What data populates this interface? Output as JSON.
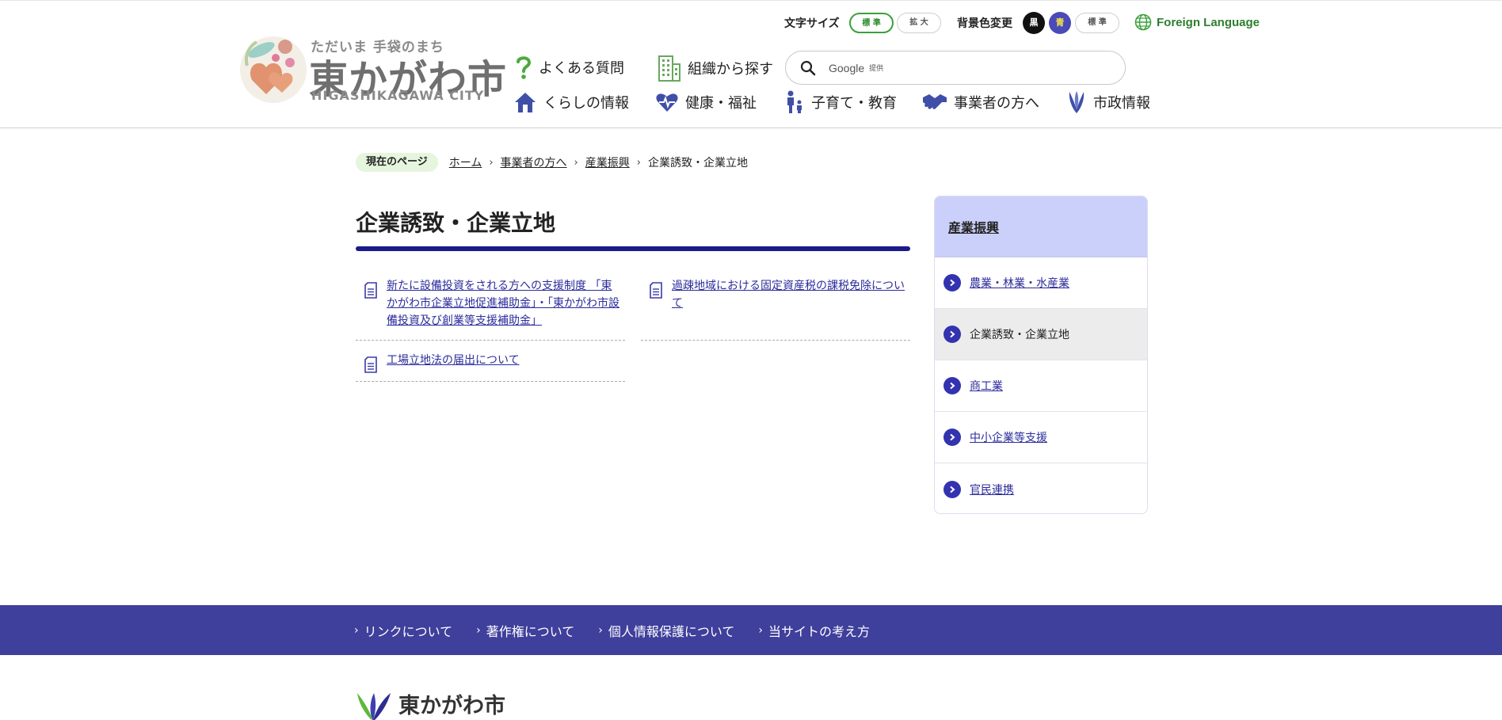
{
  "header": {
    "logo": {
      "tagline": "ただいま 手袋のまち",
      "name": "東かがわ市",
      "name_en": "HIGASHIKAGAWA CITY"
    },
    "font_size": {
      "label": "文字サイズ",
      "standard": "標 準",
      "large": "拡 大"
    },
    "background_color": {
      "label": "背景色変更",
      "black": "黒",
      "blue": "青",
      "standard": "標 準"
    },
    "foreign_language": "Foreign Language",
    "faq": "よくある質問",
    "org_search": "組織から探す",
    "search": {
      "provider": "Google",
      "provider_suffix": "提供"
    },
    "nav": [
      {
        "label": "くらしの情報",
        "icon": "house-icon"
      },
      {
        "label": "健康・福祉",
        "icon": "heart-pulse-icon"
      },
      {
        "label": "子育て・教育",
        "icon": "parent-child-icon"
      },
      {
        "label": "事業者の方へ",
        "icon": "handshake-icon"
      },
      {
        "label": "市政情報",
        "icon": "city-emblem-icon"
      }
    ]
  },
  "breadcrumb": {
    "label": "現在のページ",
    "items": [
      "ホーム",
      "事業者の方へ",
      "産業振興"
    ],
    "current": "企業誘致・企業立地"
  },
  "main": {
    "title": "企業誘致・企業立地",
    "links": [
      "新たに設備投資をされる方への支援制度 「東かがわ市企業立地促進補助金」・「東かがわ市設備投資及び創業等支援補助金」",
      "過疎地域における固定資産税の課税免除について",
      "工場立地法の届出について"
    ]
  },
  "sidebar": {
    "title": "産業振興",
    "items": [
      {
        "label": "農業・林業・水産業",
        "active": false
      },
      {
        "label": "企業誘致・企業立地",
        "active": true
      },
      {
        "label": "商工業",
        "active": false
      },
      {
        "label": "中小企業等支援",
        "active": false
      },
      {
        "label": "官民連携",
        "active": false
      }
    ]
  },
  "footer": {
    "links": [
      "リンクについて",
      "著作権について",
      "個人情報保護について",
      "当サイトの考え方"
    ],
    "logo_name": "東かがわ市"
  },
  "colors": {
    "accent_navy": "#1a1a8a",
    "footer_bar": "#3f3f9c",
    "sidebar_head": "#cbd0fb",
    "link": "#2c2c9c",
    "green": "#3aa13a"
  }
}
